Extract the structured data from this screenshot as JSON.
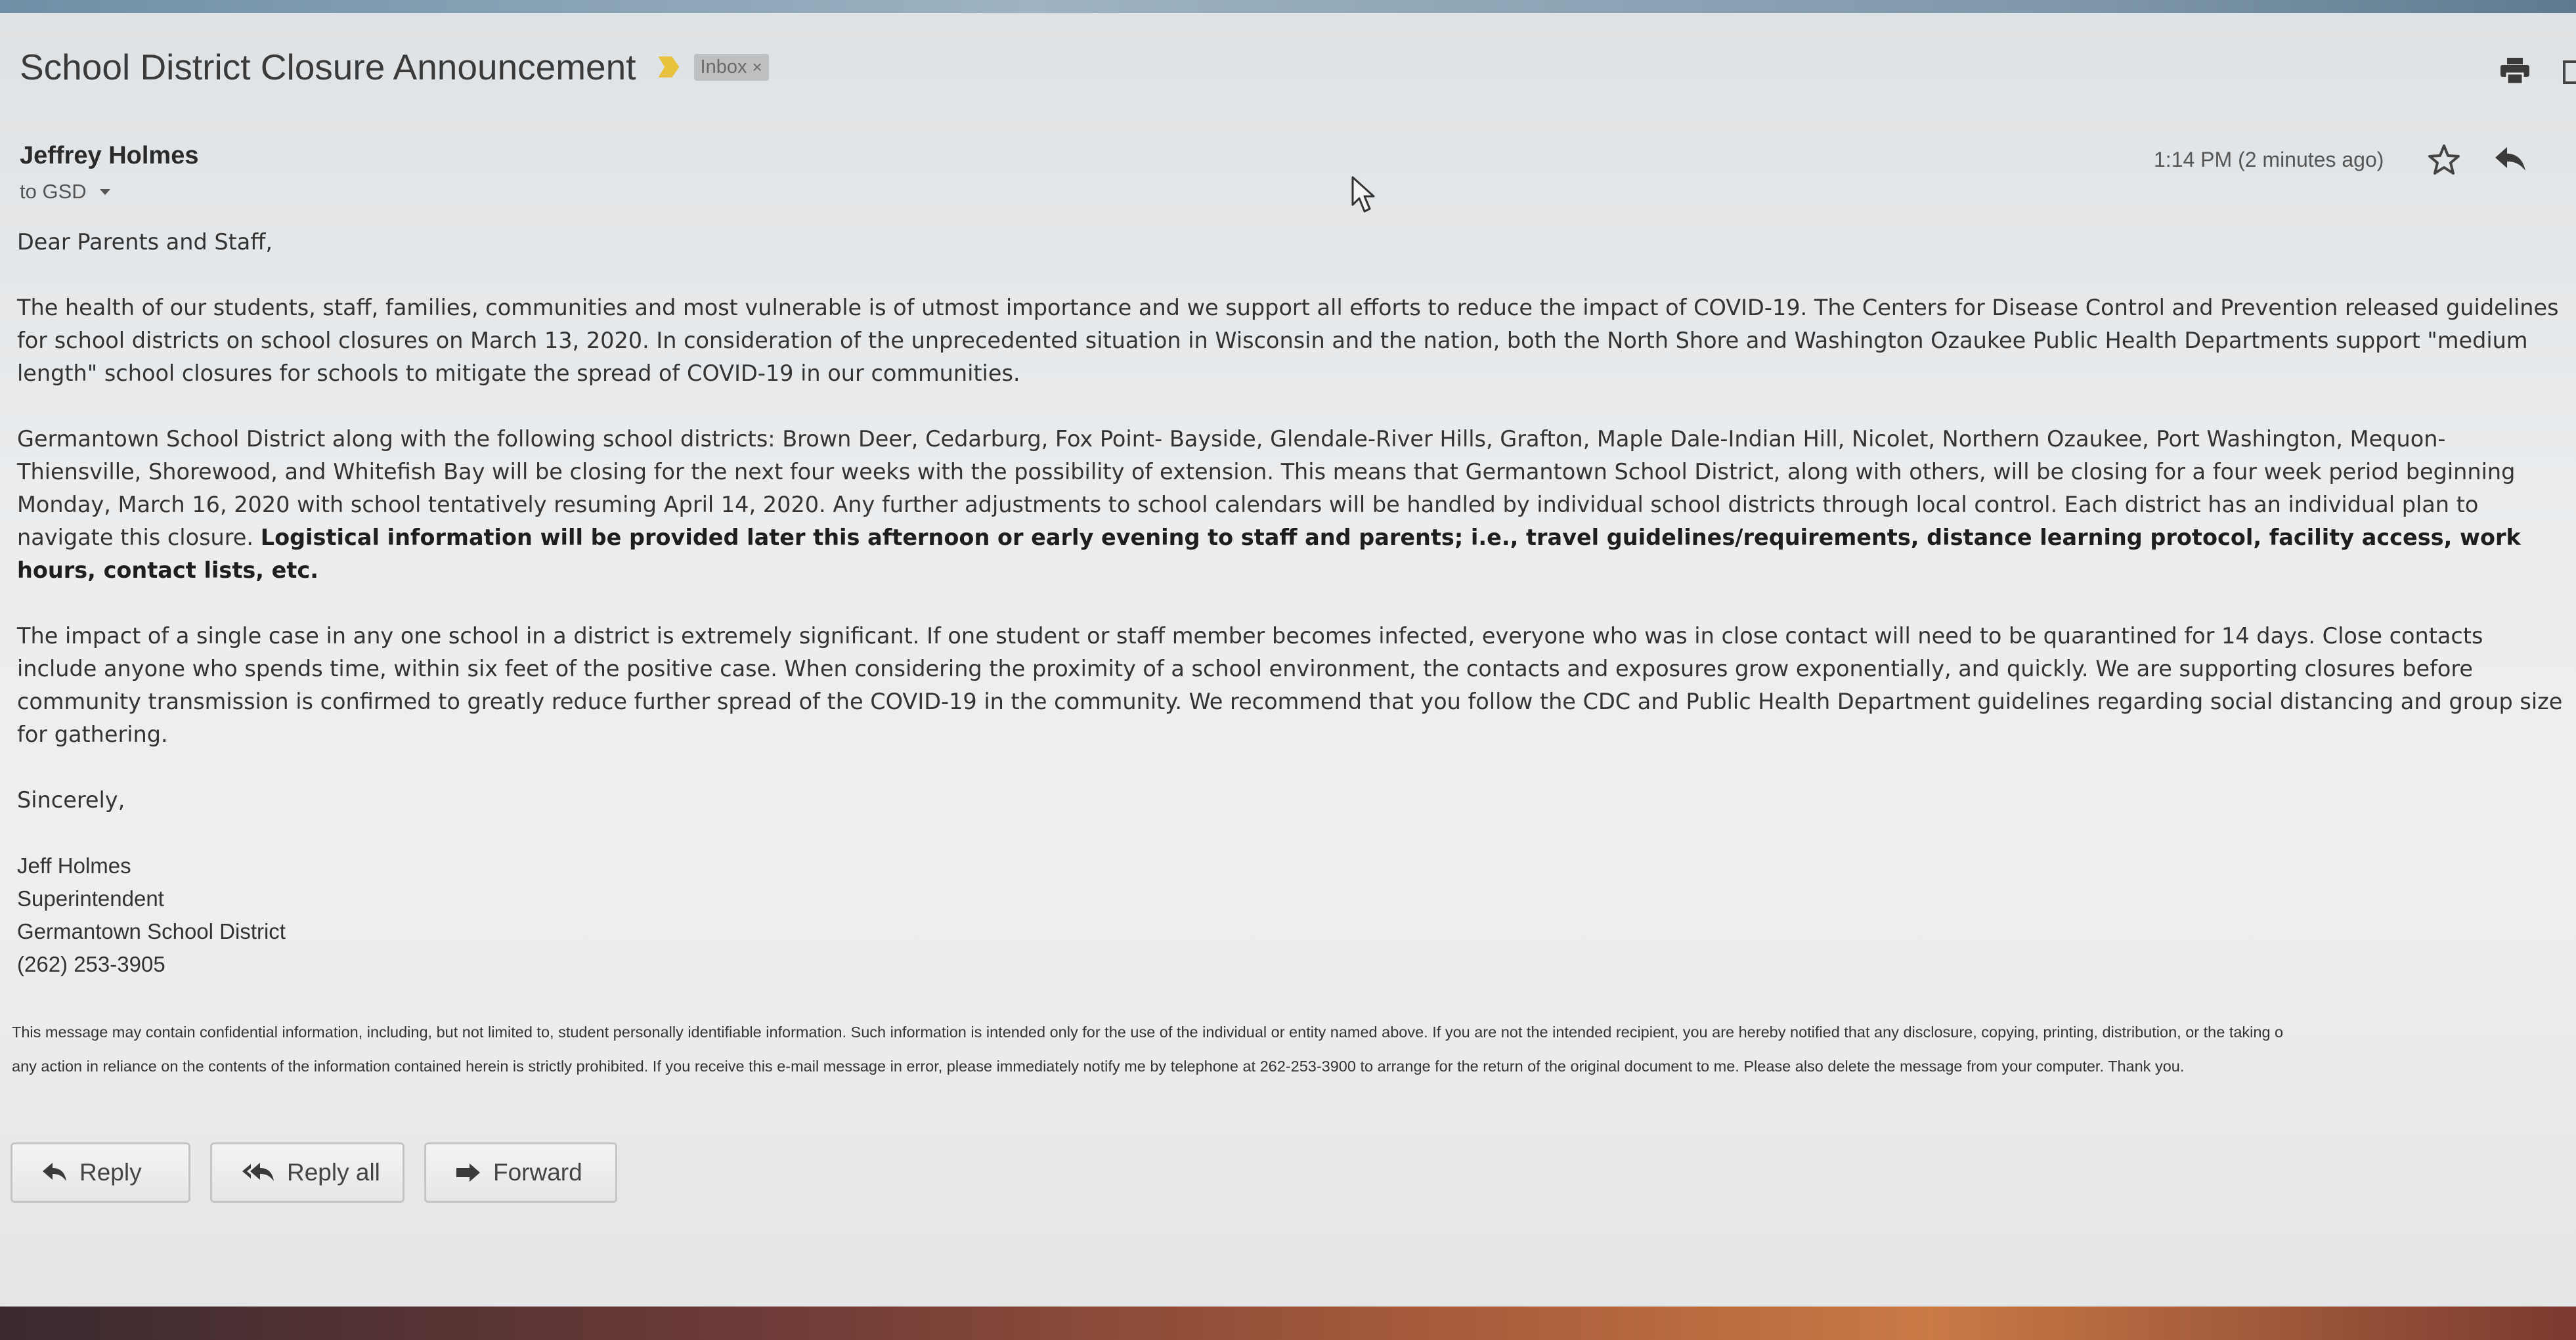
{
  "email": {
    "subject": "School District Closure Announcement",
    "label": "Inbox",
    "label_close": "×",
    "sender": "Jeffrey Holmes",
    "recipient": "to GSD",
    "timestamp": "1:14 PM (2 minutes ago)",
    "greeting": "Dear Parents and Staff,",
    "paragraph1": "The health of our students, staff, families, communities and most vulnerable is of utmost importance and we support all efforts to reduce the impact of COVID-19. The Centers for Disease Control and Prevention released guidelines for school districts on school closures on March 13, 2020.   In consideration of the unprecedented situation in Wisconsin and the nation, both the North Shore and Washington Ozaukee Public Health Departments support \"medium length\" school closures for schools to mitigate the spread of COVID-19 in our communities.",
    "paragraph2_plain": "Germantown School District along with the following school districts: Brown Deer, Cedarburg, Fox Point- Bayside, Glendale-River Hills, Grafton, Maple Dale-Indian Hill, Nicolet, Northern Ozaukee, Port Washington, Mequon-Thiensville, Shorewood, and Whitefish Bay will be closing for the next four weeks with the possibility of extension. This means that Germantown School District, along with others, will be closing for a four week period beginning Monday, March 16, 2020 with school tentatively resuming April 14, 2020. Any further adjustments to school calendars will be handled by individual school districts through local control.  Each district has an individual plan to navigate this closure.  ",
    "paragraph2_bold": "Logistical information will be provided later this afternoon or early evening to staff and parents; i.e., travel guidelines/requirements, distance learning protocol, facility access, work hours, contact lists, etc.",
    "paragraph3": "The impact of a single case in any one school in a district is extremely significant. If one student or staff member becomes infected,  everyone who was in close contact will need to be quarantined for 14 days. Close contacts include anyone who spends time, within six feet of the positive case. When considering the proximity of a school environment, the contacts and exposures grow exponentially, and quickly. We are supporting closures before community transmission is confirmed to greatly reduce further spread of the COVID-19 in the community. We recommend that you follow the CDC and Public Health Department guidelines regarding social distancing and group size for gathering.",
    "signoff": "Sincerely,",
    "signature": {
      "name": "Jeff Holmes",
      "title": "Superintendent",
      "organization": "Germantown School District",
      "phone": "(262) 253-3905"
    },
    "disclaimer_line1": "This message may contain confidential information, including, but not limited to, student personally identifiable information. Such information is intended only for the use of the individual or entity named above. If you are not the intended recipient, you are hereby notified that any disclosure, copying, printing, distribution, or the taking o",
    "disclaimer_line2": "any action in reliance on the contents of the information contained herein is strictly prohibited. If you receive this e-mail message in error, please immediately notify me by telephone at 262-253-3900 to arrange for the return of the original document to me. Please also delete the message from your computer. Thank you."
  },
  "actions": {
    "reply": "Reply",
    "reply_all": "Reply all",
    "forward": "Forward"
  },
  "icons": {
    "importance": "importance-marker-icon",
    "print": "print-icon",
    "popout": "new-window-icon",
    "star": "star-icon",
    "reply": "reply-icon",
    "reply_all": "reply-all-icon",
    "forward": "forward-icon",
    "cursor": "mouse-cursor-icon"
  },
  "colors": {
    "importance": "#e8c23a",
    "label_chip_bg": "#bdbfc0",
    "page_bg": "#e8eaec"
  }
}
